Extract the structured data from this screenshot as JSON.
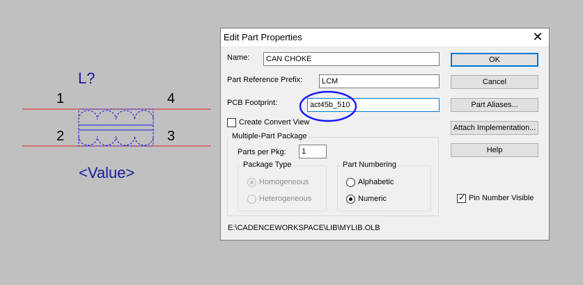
{
  "schematic": {
    "reference": "L?",
    "value": "<Value>",
    "pins": [
      "1",
      "4",
      "2",
      "3"
    ]
  },
  "dialog": {
    "title": "Edit Part Properties",
    "close_icon": "close-icon",
    "name_label": "Name:",
    "name_value": "CAN CHOKE",
    "prefix_label": "Part Reference Prefix:",
    "prefix_value": "LCM",
    "footprint_label": "PCB Footprint:",
    "footprint_value": "act45b_510",
    "convert_label": "Create Convert View",
    "convert_checked": false,
    "multi_group": "Multiple-Part Package",
    "parts_label": "Parts per Pkg:",
    "parts_value": "1",
    "package_group": "Package Type",
    "homogeneous_label": "Homogeneous",
    "heterogeneous_label": "Heterogeneous",
    "numbering_group": "Part Numbering",
    "alphabetic_label": "Alphabetic",
    "numeric_label": "Numeric",
    "numbering_selected": "Numeric",
    "pin_visible_label": "Pin Number Visible",
    "pin_visible_checked": true,
    "path": "E:\\CADENCEWORKSPACE\\LIB\\MYLIB.OLB",
    "buttons": {
      "ok": "OK",
      "cancel": "Cancel",
      "aliases": "Part Aliases...",
      "attach": "Attach Implementation...",
      "help": "Help"
    }
  },
  "colors": {
    "annotation_circle": "#1a1aff",
    "wire": "#e02020",
    "part_body": "#1a1ae0"
  }
}
